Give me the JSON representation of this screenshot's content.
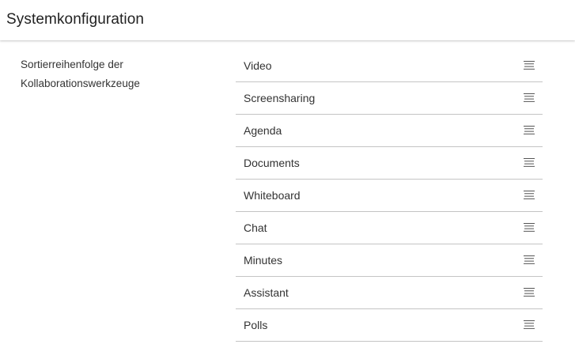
{
  "header": {
    "title": "Systemkonfiguration"
  },
  "setting": {
    "label_line1": "Sortierreihenfolge der",
    "label_line2": "Kollaborationswerkzeuge"
  },
  "tools": [
    {
      "label": "Video",
      "icon": "drag-handle-icon"
    },
    {
      "label": "Screensharing",
      "icon": "drag-handle-icon"
    },
    {
      "label": "Agenda",
      "icon": "drag-handle-icon"
    },
    {
      "label": "Documents",
      "icon": "drag-handle-icon"
    },
    {
      "label": "Whiteboard",
      "icon": "drag-handle-icon"
    },
    {
      "label": "Chat",
      "icon": "drag-handle-icon"
    },
    {
      "label": "Minutes",
      "icon": "drag-handle-icon"
    },
    {
      "label": "Assistant",
      "icon": "drag-handle-icon"
    },
    {
      "label": "Polls",
      "icon": "drag-handle-icon"
    }
  ],
  "colors": {
    "divider": "#c4c4c4",
    "text": "#333333",
    "icon": "#555555"
  }
}
